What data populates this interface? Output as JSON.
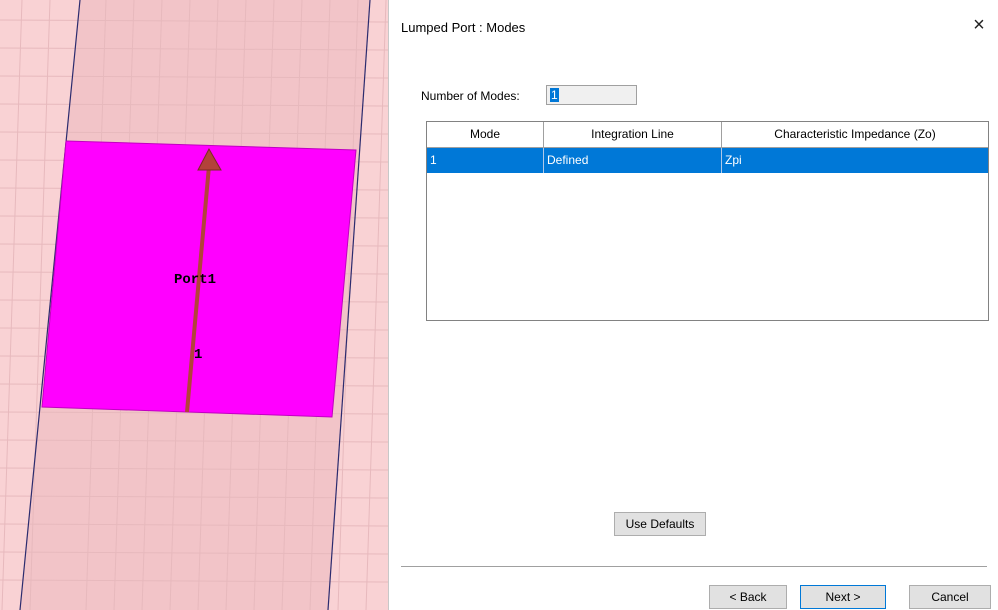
{
  "viewport": {
    "port_name": "Port1",
    "line_index": "1",
    "colors": {
      "background": "#f9d2d4",
      "port_sheet": "#ff00ff",
      "arrow": "#b3423a"
    }
  },
  "dialog": {
    "title": "Lumped Port : Modes",
    "close_icon": "×",
    "number_of_modes_label": "Number of Modes:",
    "number_of_modes_value": "1",
    "table": {
      "columns": [
        "Mode",
        "Integration Line",
        "Characteristic Impedance (Zo)"
      ],
      "rows": [
        {
          "mode": "1",
          "integration_line": "Defined",
          "impedance": "Zpi"
        }
      ]
    },
    "use_defaults_label": "Use Defaults",
    "back_label": "< Back",
    "next_label": "Next >",
    "cancel_label": "Cancel",
    "accent_color": "#0078d7"
  }
}
